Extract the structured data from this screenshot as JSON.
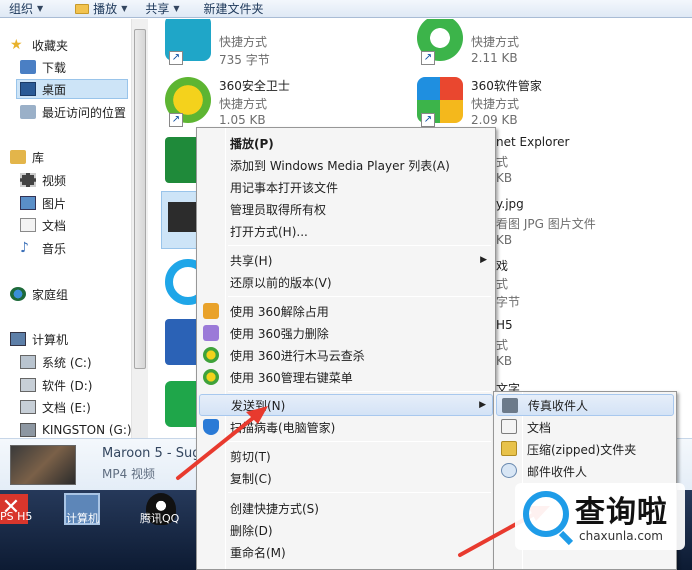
{
  "toolbar": {
    "organize": "组织",
    "play": "播放",
    "share": "共享",
    "new_folder": "新建文件夹"
  },
  "nav": {
    "favorites": "收藏夹",
    "downloads": "下载",
    "desktop": "桌面",
    "recent": "最近访问的位置",
    "libraries": "库",
    "videos": "视频",
    "pictures": "图片",
    "documents": "文档",
    "music": "音乐",
    "homegroup": "家庭组",
    "computer": "计算机",
    "drive_c": "系统 (C:)",
    "drive_d": "软件 (D:)",
    "drive_e": "文档 (E:)",
    "drive_g": "KINGSTON (G:)"
  },
  "files": [
    {
      "name": "",
      "type": "快捷方式",
      "size": "735 字节"
    },
    {
      "name": "",
      "type": "快捷方式",
      "size": "2.11 KB"
    },
    {
      "name": "360安全卫士",
      "type": "快捷方式",
      "size": "1.05 KB"
    },
    {
      "name": "360软件管家",
      "type": "快捷方式",
      "size": "2.09 KB"
    }
  ],
  "partials": {
    "ie_name": "net Explorer",
    "ie_type": "式",
    "ie_size": "KB",
    "jpg_name": "y.jpg",
    "jpg_type": "看图 JPG 图片文件",
    "jpg_size": "KB",
    "game_name": "戏",
    "game_type": "式",
    "game_size": "字节",
    "h5_name": "H5",
    "h5_type": "式",
    "h5_size": "KB",
    "text_name": "文字"
  },
  "details": {
    "title": "Maroon 5 - Sug",
    "type": "MP4 视频"
  },
  "taskbar": {
    "ps": "PS H5",
    "computer": "计算机",
    "qq": "腾讯QQ"
  },
  "context_menu": {
    "play": "播放(P)",
    "add_wmp": "添加到 Windows Media Player 列表(A)",
    "notepad": "用记事本打开该文件",
    "admin": "管理员取得所有权",
    "open_with": "打开方式(H)...",
    "share": "共享(H)",
    "restore": "还原以前的版本(V)",
    "unlock_360": "使用 360解除占用",
    "force_delete_360": "使用 360强力删除",
    "trojan_360": "使用 360进行木马云查杀",
    "menu_mgr_360": "使用 360管理右键菜单",
    "send_to": "发送到(N)",
    "virus": "扫描病毒(电脑管家)",
    "cut": "剪切(T)",
    "copy": "复制(C)",
    "shortcut": "创建快捷方式(S)",
    "delete": "删除(D)",
    "rename": "重命名(M)"
  },
  "send_to_menu": {
    "fax": "传真收件人",
    "docs": "文档",
    "zip": "压缩(zipped)文件夹",
    "mail": "邮件收件人"
  },
  "watermark": {
    "cn": "查询啦",
    "en": "chaxunla.com"
  },
  "colors": {
    "highlight": "#d4e3f6",
    "arrow_red": "#e83a2e",
    "brand_blue": "#1e9ce8"
  }
}
